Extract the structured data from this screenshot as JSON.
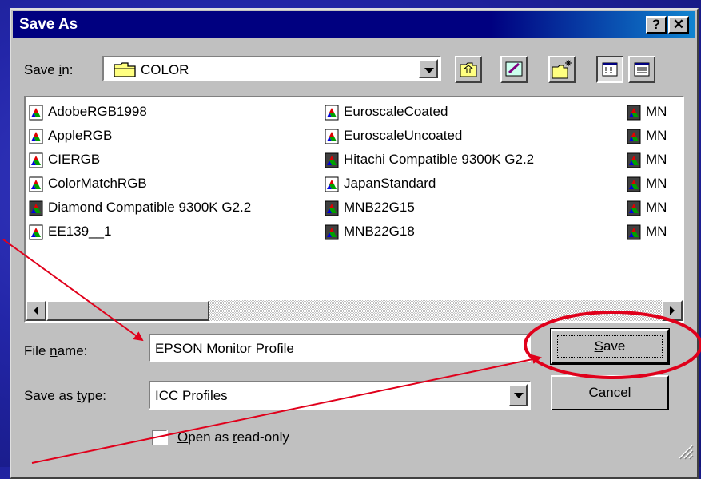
{
  "dialog": {
    "title": "Save As",
    "help_button": "?",
    "close_button": "✕"
  },
  "save_in": {
    "label_pre": "Save ",
    "label_key": "i",
    "label_post": "n:",
    "value": "COLOR"
  },
  "files": {
    "col1": [
      "AdobeRGB1998",
      "AppleRGB",
      "CIERGB",
      "ColorMatchRGB",
      "Diamond Compatible 9300K G2.2",
      "EE139__1"
    ],
    "col2": [
      "EuroscaleCoated",
      "EuroscaleUncoated",
      "Hitachi Compatible 9300K G2.2",
      "JapanStandard",
      "MNB22G15",
      "MNB22G18"
    ],
    "col3": [
      "MN",
      "MN",
      "MN",
      "MN",
      "MN",
      "MN"
    ]
  },
  "file_name": {
    "label_pre": "File ",
    "label_key": "n",
    "label_post": "ame:",
    "value": "EPSON Monitor Profile"
  },
  "save_type": {
    "label_pre": "Save as ",
    "label_key": "t",
    "label_post": "ype:",
    "value": "ICC Profiles"
  },
  "buttons": {
    "save_key": "S",
    "save_rest": "ave",
    "cancel": "Cancel"
  },
  "readonly": {
    "key": "O",
    "text_a": "pen as ",
    "key2": "r",
    "text_b": "ead-only"
  },
  "annotation_color": "#e0001b"
}
